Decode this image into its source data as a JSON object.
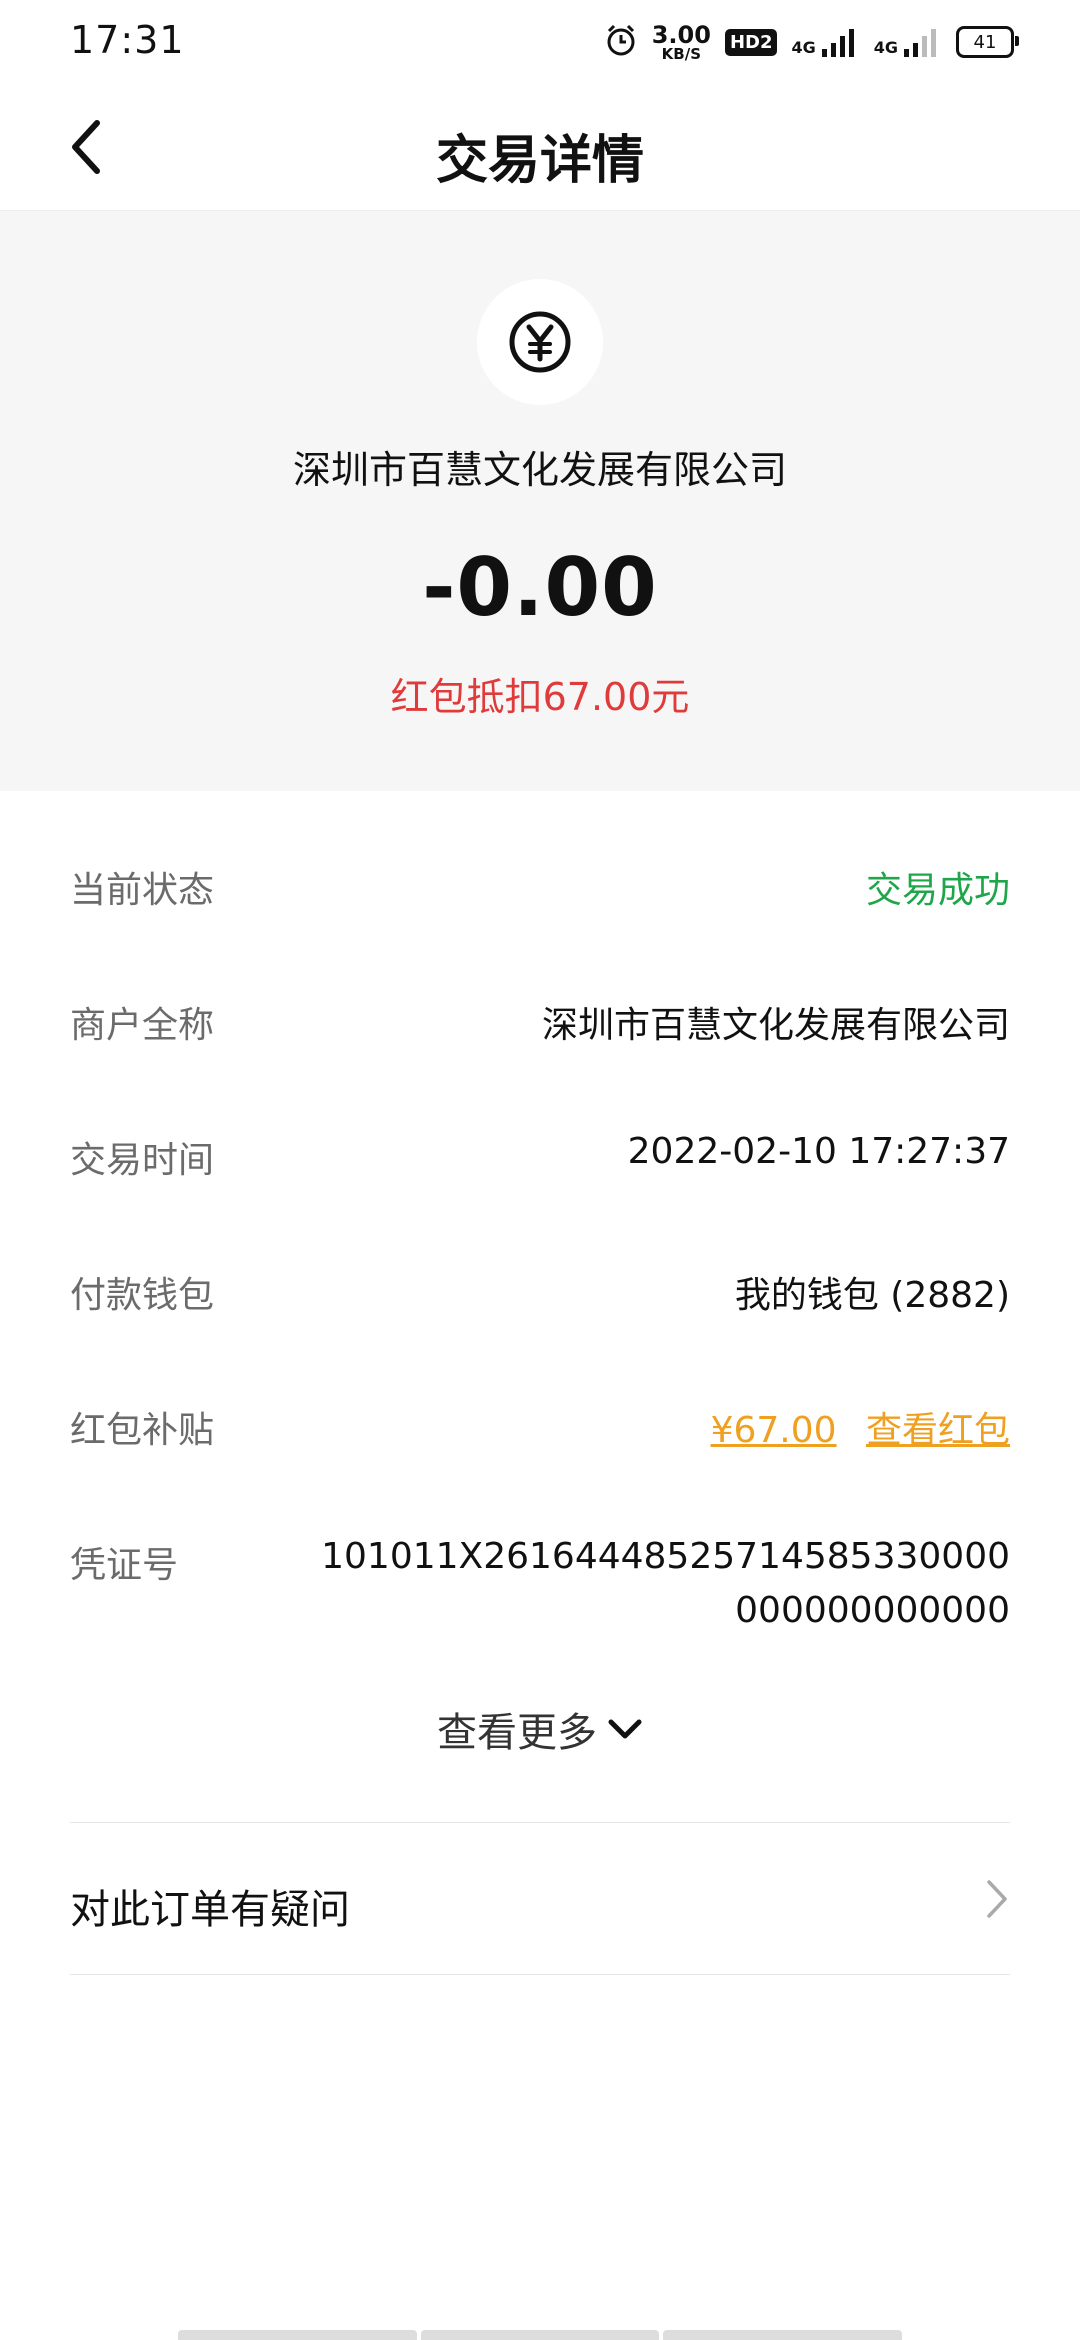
{
  "status_bar": {
    "time": "17:31",
    "net_speed_value": "3.00",
    "net_speed_unit": "KB/S",
    "hd_label": "HD2",
    "sim1_label": "4G",
    "sim2_label": "4G",
    "battery": "41"
  },
  "nav": {
    "title": "交易详情"
  },
  "summary": {
    "logo_icon": "yuan-coin-icon",
    "merchant": "深圳市百慧文化发展有限公司",
    "amount": "-0.00",
    "discount": "红包抵扣67.00元"
  },
  "details": {
    "status": {
      "label": "当前状态",
      "value": "交易成功"
    },
    "merchant": {
      "label": "商户全称",
      "value": "深圳市百慧文化发展有限公司"
    },
    "time": {
      "label": "交易时间",
      "value": "2022-02-10 17:27:37"
    },
    "wallet": {
      "label": "付款钱包",
      "value": "我的钱包 (2882)"
    },
    "subsidy": {
      "label": "红包补贴",
      "amount": "¥67.00",
      "link": "查看红包"
    },
    "voucher": {
      "label": "凭证号",
      "value": "101011X26164448525714585330000000000000000"
    }
  },
  "more": {
    "label": "查看更多"
  },
  "question": {
    "label": "对此订单有疑问"
  },
  "colors": {
    "success": "#1fa64a",
    "discount": "#e03b3b",
    "link": "#f0a020",
    "summary_bg": "#f6f6f7"
  }
}
